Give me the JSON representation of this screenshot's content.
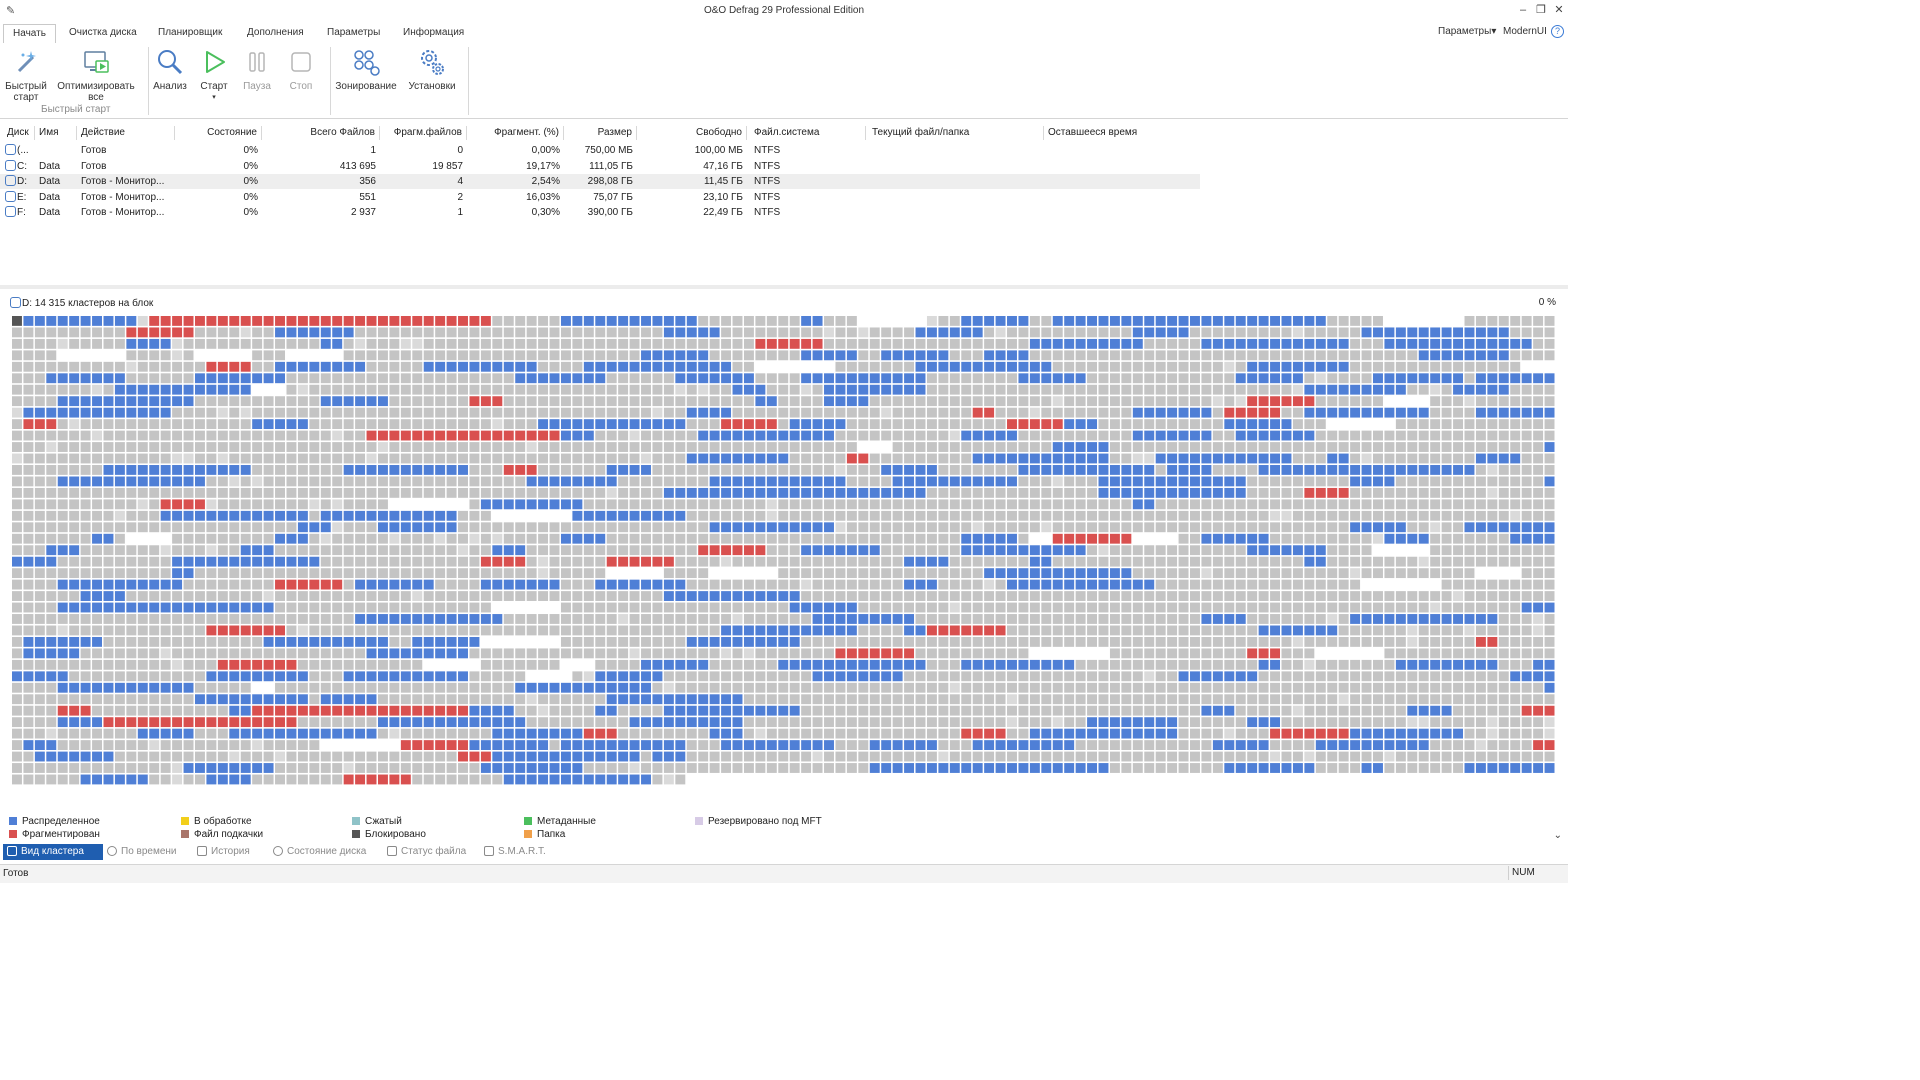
{
  "window": {
    "title": "O&O Defrag 29 Professional Edition",
    "minimize_icon": "minimize-icon",
    "restore_icon": "restore-icon",
    "close_icon": "close-icon"
  },
  "tabs": [
    {
      "label": "Начать",
      "active": true
    },
    {
      "label": "Очистка диска"
    },
    {
      "label": "Планировщик"
    },
    {
      "label": "Дополнения"
    },
    {
      "label": "Параметры"
    },
    {
      "label": "Информация"
    }
  ],
  "tabs_right": {
    "params_label": "Параметры",
    "ui_label": "ModernUI",
    "help_icon": "help-icon"
  },
  "ribbon": {
    "quick_start": "Быстрый старт",
    "optimize_all": "Оптимизировать все",
    "group_label": "Быстрый старт",
    "analyze": "Анализ",
    "start": "Старт",
    "pause": "Пауза",
    "stop": "Стоп",
    "zoning": "Зонирование",
    "settings": "Установки"
  },
  "drive_table": {
    "columns": [
      "Диск",
      "Имя",
      "Действие",
      "Состояние",
      "Всего Файлов",
      "Фрагм.файлов",
      "Фрагмент. (%)",
      "Размер",
      "Свободно",
      "Файл.система",
      "Текущий файл/папка",
      "Оставшееся время"
    ],
    "rows": [
      {
        "disk": "(...",
        "name": "",
        "action": "Готов",
        "state": "0%",
        "total": "1",
        "frag_files": "0",
        "frag_pct": "0,00%",
        "size": "750,00 МБ",
        "free": "100,00 МБ",
        "fs": "NTFS"
      },
      {
        "disk": "C:",
        "name": "Data",
        "action": "Готов",
        "state": "0%",
        "total": "413 695",
        "frag_files": "19 857",
        "frag_pct": "19,17%",
        "size": "111,05 ГБ",
        "free": "47,16 ГБ",
        "fs": "NTFS"
      },
      {
        "disk": "D:",
        "name": "Data",
        "action": "Готов - Монитор...",
        "state": "0%",
        "total": "356",
        "frag_files": "4",
        "frag_pct": "2,54%",
        "size": "298,08 ГБ",
        "free": "11,45 ГБ",
        "fs": "NTFS",
        "selected": true
      },
      {
        "disk": "E:",
        "name": "Data",
        "action": "Готов - Монитор...",
        "state": "0%",
        "total": "551",
        "frag_files": "2",
        "frag_pct": "16,03%",
        "size": "75,07 ГБ",
        "free": "23,10 ГБ",
        "fs": "NTFS"
      },
      {
        "disk": "F:",
        "name": "Data",
        "action": "Готов - Монитор...",
        "state": "0%",
        "total": "2 937",
        "frag_files": "1",
        "frag_pct": "0,30%",
        "size": "390,00 ГБ",
        "free": "22,49 ГБ",
        "fs": "NTFS"
      }
    ]
  },
  "cluster_map": {
    "header": "D: 14 315 кластеров на блок",
    "percent": "0 %",
    "cols": 135,
    "rows": 41,
    "last_row_filled": 59,
    "seed": 29,
    "colors": {
      "empty": "#c4c4c4",
      "free": "#ffffff",
      "allocated": "#4f7fd6",
      "fragmented": "#d9504f",
      "locked": "#555555",
      "light": "#dadada",
      "mft": "#d7cbe6"
    }
  },
  "legend": [
    {
      "label": "Распределенное",
      "color": "#4f7fd6"
    },
    {
      "label": "Фрагментирован",
      "color": "#d9504f"
    },
    {
      "label": "В обработке",
      "color": "#f2cf1b"
    },
    {
      "label": "Файл подкачки",
      "color": "#a9756a"
    },
    {
      "label": "Сжатый",
      "color": "#8fc3c8"
    },
    {
      "label": "Блокировано",
      "color": "#555555"
    },
    {
      "label": "Метаданные",
      "color": "#4bbf5d"
    },
    {
      "label": "Папка",
      "color": "#f0a04a"
    },
    {
      "label": "Резервировано под MFT",
      "color": "#d7cbe6"
    }
  ],
  "view_tabs": [
    {
      "label": "Вид кластера",
      "active": true
    },
    {
      "label": "По времени"
    },
    {
      "label": "История"
    },
    {
      "label": "Состояние диска"
    },
    {
      "label": "Статус файла"
    },
    {
      "label": "S.M.A.R.T."
    }
  ],
  "status": {
    "text": "Готов",
    "num": "NUM"
  }
}
